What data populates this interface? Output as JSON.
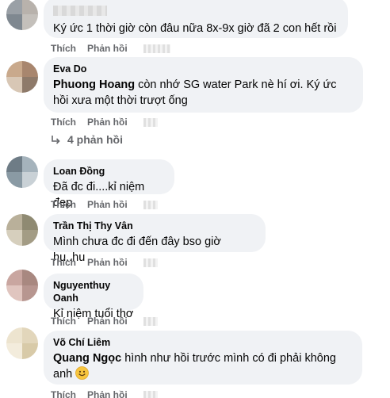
{
  "comments": [
    {
      "author": "",
      "mention": "",
      "text": "Ký ức 1 thời giờ còn đâu nữa 8x-9x giờ đã 2 con hết rồi",
      "like_label": "Thích",
      "reply_label": "Phản hồi"
    },
    {
      "author": "Eva Do",
      "mention": "Phuong Hoang",
      "text": " còn nhớ SG water Park nè hí ơi. Ký ức hồi xưa một thời trượt ống",
      "like_label": "Thích",
      "reply_label": "Phản hồi",
      "replies_label": "4 phản hồi"
    },
    {
      "author": "Loan Đồng",
      "mention": "",
      "text": "Đã đc đi....kỉ niệm đẹp",
      "like_label": "Thích",
      "reply_label": "Phản hồi"
    },
    {
      "author": "Trần Thị Thy Vân",
      "mention": "",
      "text": "Mình chưa đc đi đến đây bso giờ hu..hu",
      "like_label": "Thích",
      "reply_label": "Phản hồi"
    },
    {
      "author": "Nguyenthuy Oanh",
      "mention": "",
      "text": "Kỉ niệm tuổi thơ",
      "like_label": "Thích",
      "reply_label": "Phản hồi"
    },
    {
      "author": "Võ Chí Liêm",
      "mention": "Quang Ngọc",
      "text": " hình như hồi trước mình có đi phải không anh",
      "like_label": "Thích",
      "reply_label": "Phản hồi"
    }
  ],
  "icons": {
    "reply_arrow": "reply-arrow-icon",
    "emoji": "smiling-face-icon"
  },
  "colors": {
    "bubble_bg": "#f0f2f5",
    "secondary_text": "#65676b"
  }
}
